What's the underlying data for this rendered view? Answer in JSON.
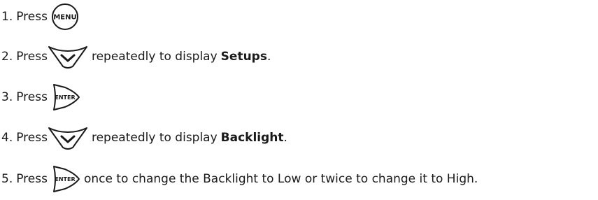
{
  "steps": [
    {
      "number": "1.",
      "pre": "Press",
      "key": "menu-key",
      "key_label": "MENU",
      "post": "",
      "emph": "",
      "tail": ""
    },
    {
      "number": "2.",
      "pre": "Press",
      "key": "down-arrow-key",
      "key_label": "",
      "post": "repeatedly to display",
      "emph": "Setups",
      "tail": "."
    },
    {
      "number": "3.",
      "pre": "Press",
      "key": "enter-key",
      "key_label": "ENTER",
      "post": "",
      "emph": "",
      "tail": ""
    },
    {
      "number": "4.",
      "pre": "Press",
      "key": "down-arrow-key",
      "key_label": "",
      "post": "repeatedly to display",
      "emph": "Backlight",
      "tail": "."
    },
    {
      "number": "5.",
      "pre": "Press",
      "key": "enter-key",
      "key_label": "ENTER",
      "post": "once to change the Backlight to Low or twice to change it to High.",
      "emph": "",
      "tail": ""
    }
  ]
}
